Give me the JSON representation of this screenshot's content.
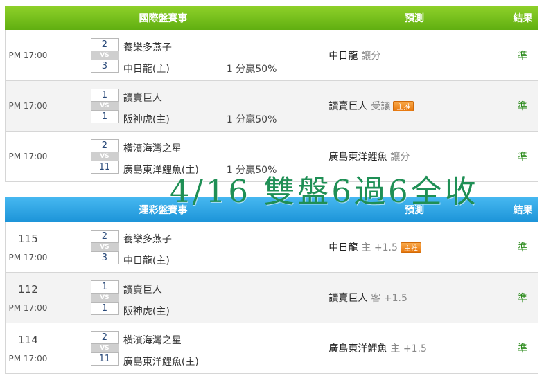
{
  "sections": [
    {
      "header": {
        "event": "國際盤賽事",
        "prediction": "預測",
        "result": "結果"
      },
      "rows": [
        {
          "number": "",
          "time": "PM 17:00",
          "score1": "2",
          "vs": "VS",
          "score2": "3",
          "team1": "養樂多燕子",
          "team2": "中日龍(主)",
          "spread": "1 分贏50%",
          "pick": "中日龍",
          "type": "讓分",
          "tag": "",
          "result": "準"
        },
        {
          "number": "",
          "time": "PM 17:00",
          "score1": "1",
          "vs": "VS",
          "score2": "1",
          "team1": "讀賣巨人",
          "team2": "阪神虎(主)",
          "spread": "1 分贏50%",
          "pick": "讀賣巨人",
          "type": "受讓",
          "tag": "主推",
          "result": "準"
        },
        {
          "number": "",
          "time": "PM 17:00",
          "score1": "2",
          "vs": "VS",
          "score2": "11",
          "team1": "橫濱海灣之星",
          "team2": "廣島東洋鯉魚(主)",
          "spread": "1 分贏50%",
          "pick": "廣島東洋鯉魚",
          "type": "讓分",
          "tag": "",
          "result": "準"
        }
      ]
    },
    {
      "header": {
        "event": "運彩盤賽事",
        "prediction": "預測",
        "result": "結果"
      },
      "rows": [
        {
          "number": "115",
          "time": "PM 17:00",
          "score1": "2",
          "vs": "VS",
          "score2": "3",
          "team1": "養樂多燕子",
          "team2": "中日龍(主)",
          "spread": "",
          "pick": "中日龍",
          "type": "主 +1.5",
          "tag": "主推",
          "result": "準"
        },
        {
          "number": "112",
          "time": "PM 17:00",
          "score1": "1",
          "vs": "VS",
          "score2": "1",
          "team1": "讀賣巨人",
          "team2": "阪神虎(主)",
          "spread": "",
          "pick": "讀賣巨人",
          "type": "客 +1.5",
          "tag": "",
          "result": "準"
        },
        {
          "number": "114",
          "time": "PM 17:00",
          "score1": "2",
          "vs": "VS",
          "score2": "11",
          "team1": "橫濱海灣之星",
          "team2": "廣島東洋鯉魚(主)",
          "spread": "",
          "pick": "廣島東洋鯉魚",
          "type": "主 +1.5",
          "tag": "",
          "result": "準"
        }
      ]
    }
  ],
  "overlay_text": "4/16 雙盤6過6全收"
}
